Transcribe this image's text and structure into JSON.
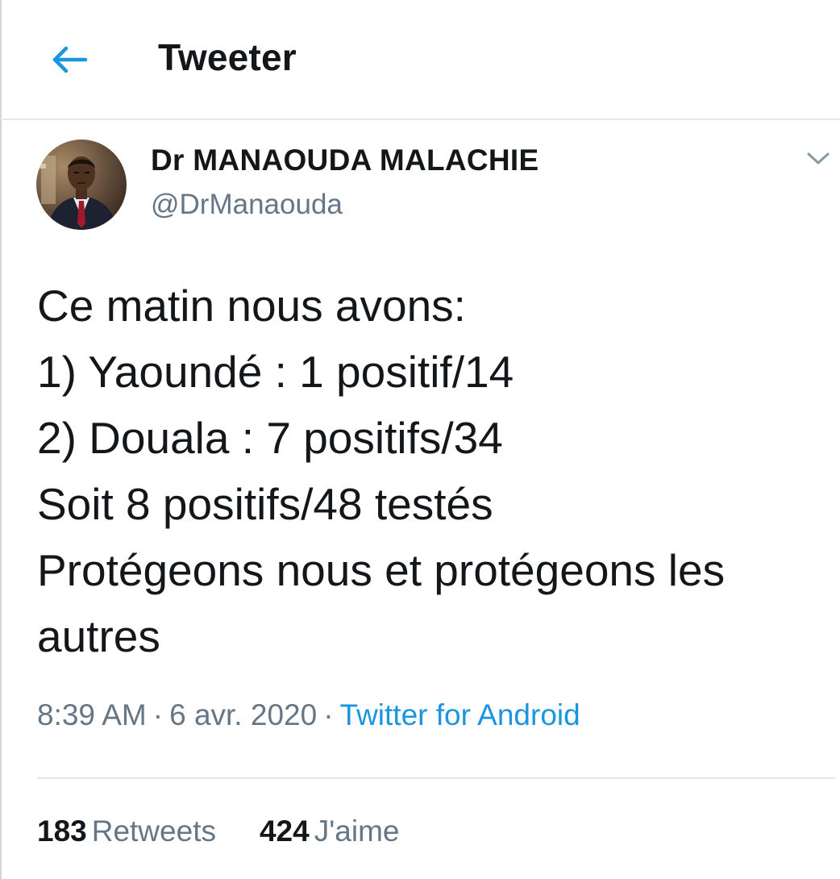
{
  "header": {
    "back_icon": "arrow-left-icon",
    "title": "Tweeter"
  },
  "tweet": {
    "author": {
      "display_name": "Dr MANAOUDA MALACHIE",
      "handle": "@DrManaouda",
      "avatar_icon": "profile-photo"
    },
    "menu_icon": "chevron-down-icon",
    "text_lines": [
      "Ce matin nous avons:",
      "1) Yaoundé : 1 positif/14",
      "2) Douala : 7 positifs/34",
      "Soit 8 positifs/48 testés",
      "Protégeons nous et protégeons les",
      "autres"
    ],
    "meta": {
      "time": "8:39 AM",
      "separator": "·",
      "date": "6 avr. 2020",
      "source": "Twitter for Android"
    },
    "stats": {
      "retweets_count": "183",
      "retweets_label": "Retweets",
      "likes_count": "424",
      "likes_label": "J'aime"
    }
  },
  "colors": {
    "accent": "#1b95e0",
    "text_primary": "#14171a",
    "text_secondary": "#657786",
    "divider": "#e1e8ed"
  }
}
